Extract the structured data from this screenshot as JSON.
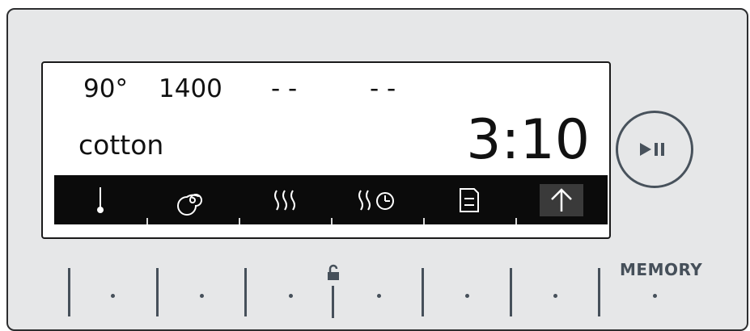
{
  "display": {
    "status_values": [
      "90°",
      "1400",
      "- -",
      "- -"
    ],
    "program": "cotton",
    "time": "3:10"
  },
  "icon_bar": {
    "icons": [
      "thermometer-icon",
      "spiral-icon",
      "steam-icon",
      "steam-timer-icon",
      "document-icon",
      "arrow-up-icon"
    ],
    "selected_index": 5
  },
  "controls": {
    "memory_label": "MEMORY",
    "play_pause_icon": "play-pause-icon",
    "lock_icon": "padlock-icon"
  },
  "colors": {
    "panel": "#e6e7e8",
    "display_bg": "#ffffff",
    "icon_bar_bg": "#0b0b0b",
    "control_accent": "#46505a"
  }
}
